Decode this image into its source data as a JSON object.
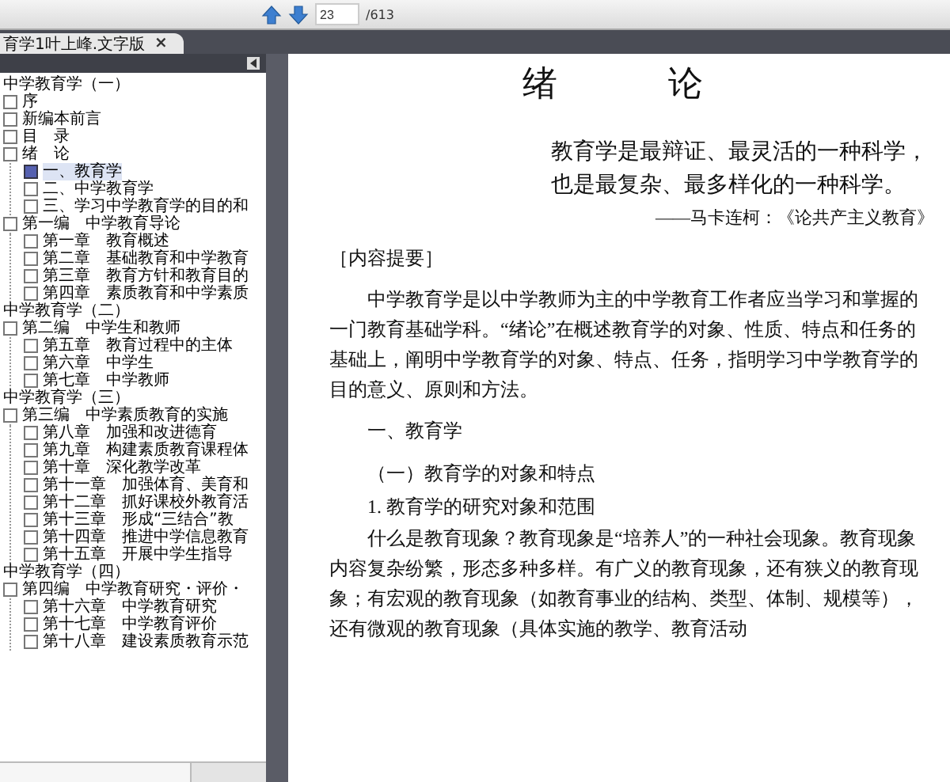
{
  "toolbar": {
    "page": "23",
    "total": "/613"
  },
  "tab": {
    "title": "育学1叶上峰.文字版",
    "close": "×"
  },
  "outline": [
    {
      "title": "中学教育学（一）",
      "items": [
        {
          "label": "序",
          "selected": false
        },
        {
          "label": "新编本前言",
          "selected": false
        },
        {
          "label": "目　录",
          "selected": false
        },
        {
          "label": "绪　论",
          "selected": false,
          "children": [
            {
              "label": "一、教育学",
              "selected": true
            },
            {
              "label": "二、中学教育学",
              "selected": false
            },
            {
              "label": "三、学习中学教育学的目的和",
              "selected": false
            }
          ]
        },
        {
          "label": "第一编　中学教育导论",
          "selected": false,
          "children": [
            {
              "label": "第一章　教育概述",
              "selected": false
            },
            {
              "label": "第二章　基础教育和中学教育",
              "selected": false
            },
            {
              "label": "第三章　教育方针和教育目的",
              "selected": false
            },
            {
              "label": "第四章　素质教育和中学素质",
              "selected": false
            }
          ]
        }
      ]
    },
    {
      "title": "中学教育学（二）",
      "items": [
        {
          "label": "第二编　中学生和教师",
          "selected": false,
          "children": [
            {
              "label": "第五章　教育过程中的主体",
              "selected": false
            },
            {
              "label": "第六章　中学生",
              "selected": false
            },
            {
              "label": "第七章　中学教师",
              "selected": false
            }
          ]
        }
      ]
    },
    {
      "title": "中学教育学（三）",
      "items": [
        {
          "label": "第三编　中学素质教育的实施",
          "selected": false,
          "children": [
            {
              "label": "第八章　加强和改进德育",
              "selected": false
            },
            {
              "label": "第九章　构建素质教育课程体",
              "selected": false
            },
            {
              "label": "第十章　深化教学改革",
              "selected": false
            },
            {
              "label": "第十一章　加强体育、美育和",
              "selected": false
            },
            {
              "label": "第十二章　抓好课校外教育活",
              "selected": false
            },
            {
              "label": "第十三章　形成“三结合”教",
              "selected": false
            },
            {
              "label": "第十四章　推进中学信息教育",
              "selected": false
            },
            {
              "label": "第十五章　开展中学生指导",
              "selected": false
            }
          ]
        }
      ]
    },
    {
      "title": "中学教育学（四）",
      "items": [
        {
          "label": "第四编　中学教育研究・评价・",
          "selected": false,
          "children": [
            {
              "label": "第十六章　中学教育研究",
              "selected": false
            },
            {
              "label": "第十七章　中学教育评价",
              "selected": false
            },
            {
              "label": "第十八章　建设素质教育示范",
              "selected": false
            }
          ]
        }
      ]
    }
  ],
  "document": {
    "title": "绪　论",
    "epigraph": "教育学是最辩证、最灵活的一种科学，也是最复杂、最多样化的一种科学。",
    "attribution": "——马卡连柯：《论共产主义教育》",
    "blocks": [
      {
        "kind": "label",
        "text": "［内容提要］"
      },
      {
        "kind": "para",
        "text": "中学教育学是以中学教师为主的中学教育工作者应当学习和掌握的一门教育基础学科。“绪论”在概述教育学的对象、性质、特点和任务的基础上，阐明中学教育学的对象、特点、任务，指明学习中学教育学的目的意义、原则和方法。"
      },
      {
        "kind": "heading",
        "text": "一、教育学"
      },
      {
        "kind": "subheading",
        "text": "（一）教育学的对象和特点"
      },
      {
        "kind": "item",
        "text": "1. 教育学的研究对象和范围"
      },
      {
        "kind": "para",
        "text": "什么是教育现象？教育现象是“培养人”的一种社会现象。教育现象内容复杂纷繁，形态多种多样。有广义的教育现象，还有狭义的教育现象；有宏观的教育现象（如教育事业的结构、类型、体制、规模等），还有微观的教育现象（具体实施的教学、教育活动"
      }
    ]
  }
}
